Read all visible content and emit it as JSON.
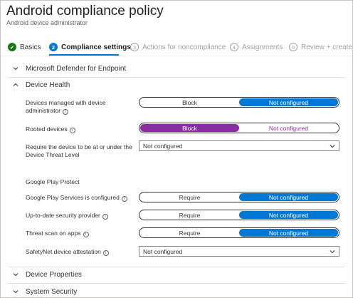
{
  "header": {
    "title": "Android compliance policy",
    "more": "···",
    "subtitle": "Android device administrator"
  },
  "steps": [
    {
      "num": "✔",
      "label": "Basics",
      "state": "done"
    },
    {
      "num": "2",
      "label": "Compliance settings",
      "state": "current"
    },
    {
      "num": "3",
      "label": "Actions for noncompliance",
      "state": "todo"
    },
    {
      "num": "4",
      "label": "Assignments",
      "state": "todo"
    },
    {
      "num": "5",
      "label": "Review + create",
      "state": "todo"
    }
  ],
  "sections": {
    "defender": "Microsoft Defender for Endpoint",
    "device_health": "Device Health",
    "device_properties": "Device Properties",
    "system_security": "System Security"
  },
  "info_glyph": "i",
  "settings": {
    "managed": {
      "label_line1": "Devices managed with device",
      "label_line2": "administrator",
      "opt1": "Block",
      "opt2": "Not configured",
      "selected": "Not configured"
    },
    "rooted": {
      "label": "Rooted devices",
      "opt1": "Block",
      "opt2": "Not configured",
      "selected": "Block"
    },
    "threat_level": {
      "label_line1": "Require the device to be at or under the",
      "label_line2": "Device Threat Level",
      "value": "Not configured"
    },
    "google_play_heading": "Google Play Protect",
    "play_services": {
      "label": "Google Play Services is configured",
      "opt1": "Require",
      "opt2": "Not configured",
      "selected": "Not configured"
    },
    "security_provider": {
      "label": "Up-to-date security provider",
      "opt1": "Require",
      "opt2": "Not configured",
      "selected": "Not configured"
    },
    "threat_scan": {
      "label": "Threat scan on apps",
      "opt1": "Require",
      "opt2": "Not configured",
      "selected": "Not configured"
    },
    "safetynet": {
      "label": "SafetyNet device attestation",
      "value": "Not configured"
    }
  },
  "colors": {
    "accent_blue": "#0078d4",
    "block_purple": "#8a2da5",
    "done_green": "#107c10"
  }
}
